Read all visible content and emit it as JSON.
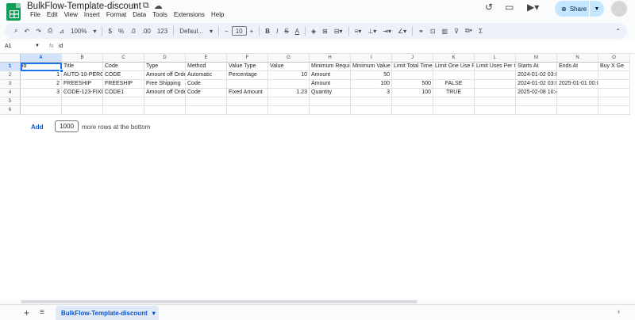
{
  "app": {
    "title": "BulkFlow-Template-discount",
    "menus": [
      "File",
      "Edit",
      "View",
      "Insert",
      "Format",
      "Data",
      "Tools",
      "Extensions",
      "Help"
    ],
    "share_label": "Share"
  },
  "toolbar": {
    "zoom": "100%",
    "currency": "$",
    "percent": "%",
    "dec_dec": ".0",
    "dec_inc": ".00",
    "num_format": "123",
    "font": "Defaul...",
    "font_size": "10",
    "bold": "B",
    "italic": "I",
    "strike": "S",
    "textcolor": "A"
  },
  "formula": {
    "cell_ref": "A1",
    "fx": "fx",
    "content": "id"
  },
  "grid": {
    "columns": [
      "A",
      "B",
      "C",
      "D",
      "E",
      "F",
      "G",
      "H",
      "I",
      "J",
      "K",
      "L",
      "M",
      "N",
      "O"
    ],
    "row_numbers": [
      "1",
      "2",
      "3",
      "4",
      "5",
      "6"
    ],
    "rows": [
      [
        "id",
        "Title",
        "Code",
        "Type",
        "Method",
        "Value Type",
        "Value",
        "Minimum Requir",
        "Minimum Value",
        "Limit Total Times",
        "Limit One Use P",
        "Limit Uses Per C",
        "Starts At",
        "Ends At",
        "Buy X Ge"
      ],
      [
        "1",
        "AUTO-10-PERC",
        "CODE",
        "Amount off Orde",
        "Automatic",
        "Percentage",
        "10",
        "Amount",
        "50",
        "",
        "",
        "",
        "2024-01-02 03:04:05 -0600",
        "",
        ""
      ],
      [
        "2",
        "FREESHIP",
        "FREESHIP",
        "Free Shipping",
        "Code",
        "",
        "",
        "Amount",
        "100",
        "500",
        "FALSE",
        "",
        "2024-01-02 03:0",
        "2025-01-01 00:00:00 -0600",
        ""
      ],
      [
        "3",
        "CODE-123-FIXE",
        "CODE1",
        "Amount off Orde",
        "Code",
        "Fixed Amount",
        "1.23",
        "Quantity",
        "3",
        "100",
        "TRUE",
        "",
        "2025-02-08 10:42:33 -0600",
        "",
        ""
      ],
      [
        "",
        "",
        "",
        "",
        "",
        "",
        "",
        "",
        "",
        "",
        "",
        "",
        "",
        "",
        ""
      ],
      [
        "",
        "",
        "",
        "",
        "",
        "",
        "",
        "",
        "",
        "",
        "",
        "",
        "",
        "",
        ""
      ]
    ]
  },
  "add_rows": {
    "add_label": "Add",
    "count": "1000",
    "suffix": "more rows at the bottom"
  },
  "sheets": {
    "tabs": [
      "BulkFlow-Template-discount"
    ]
  }
}
